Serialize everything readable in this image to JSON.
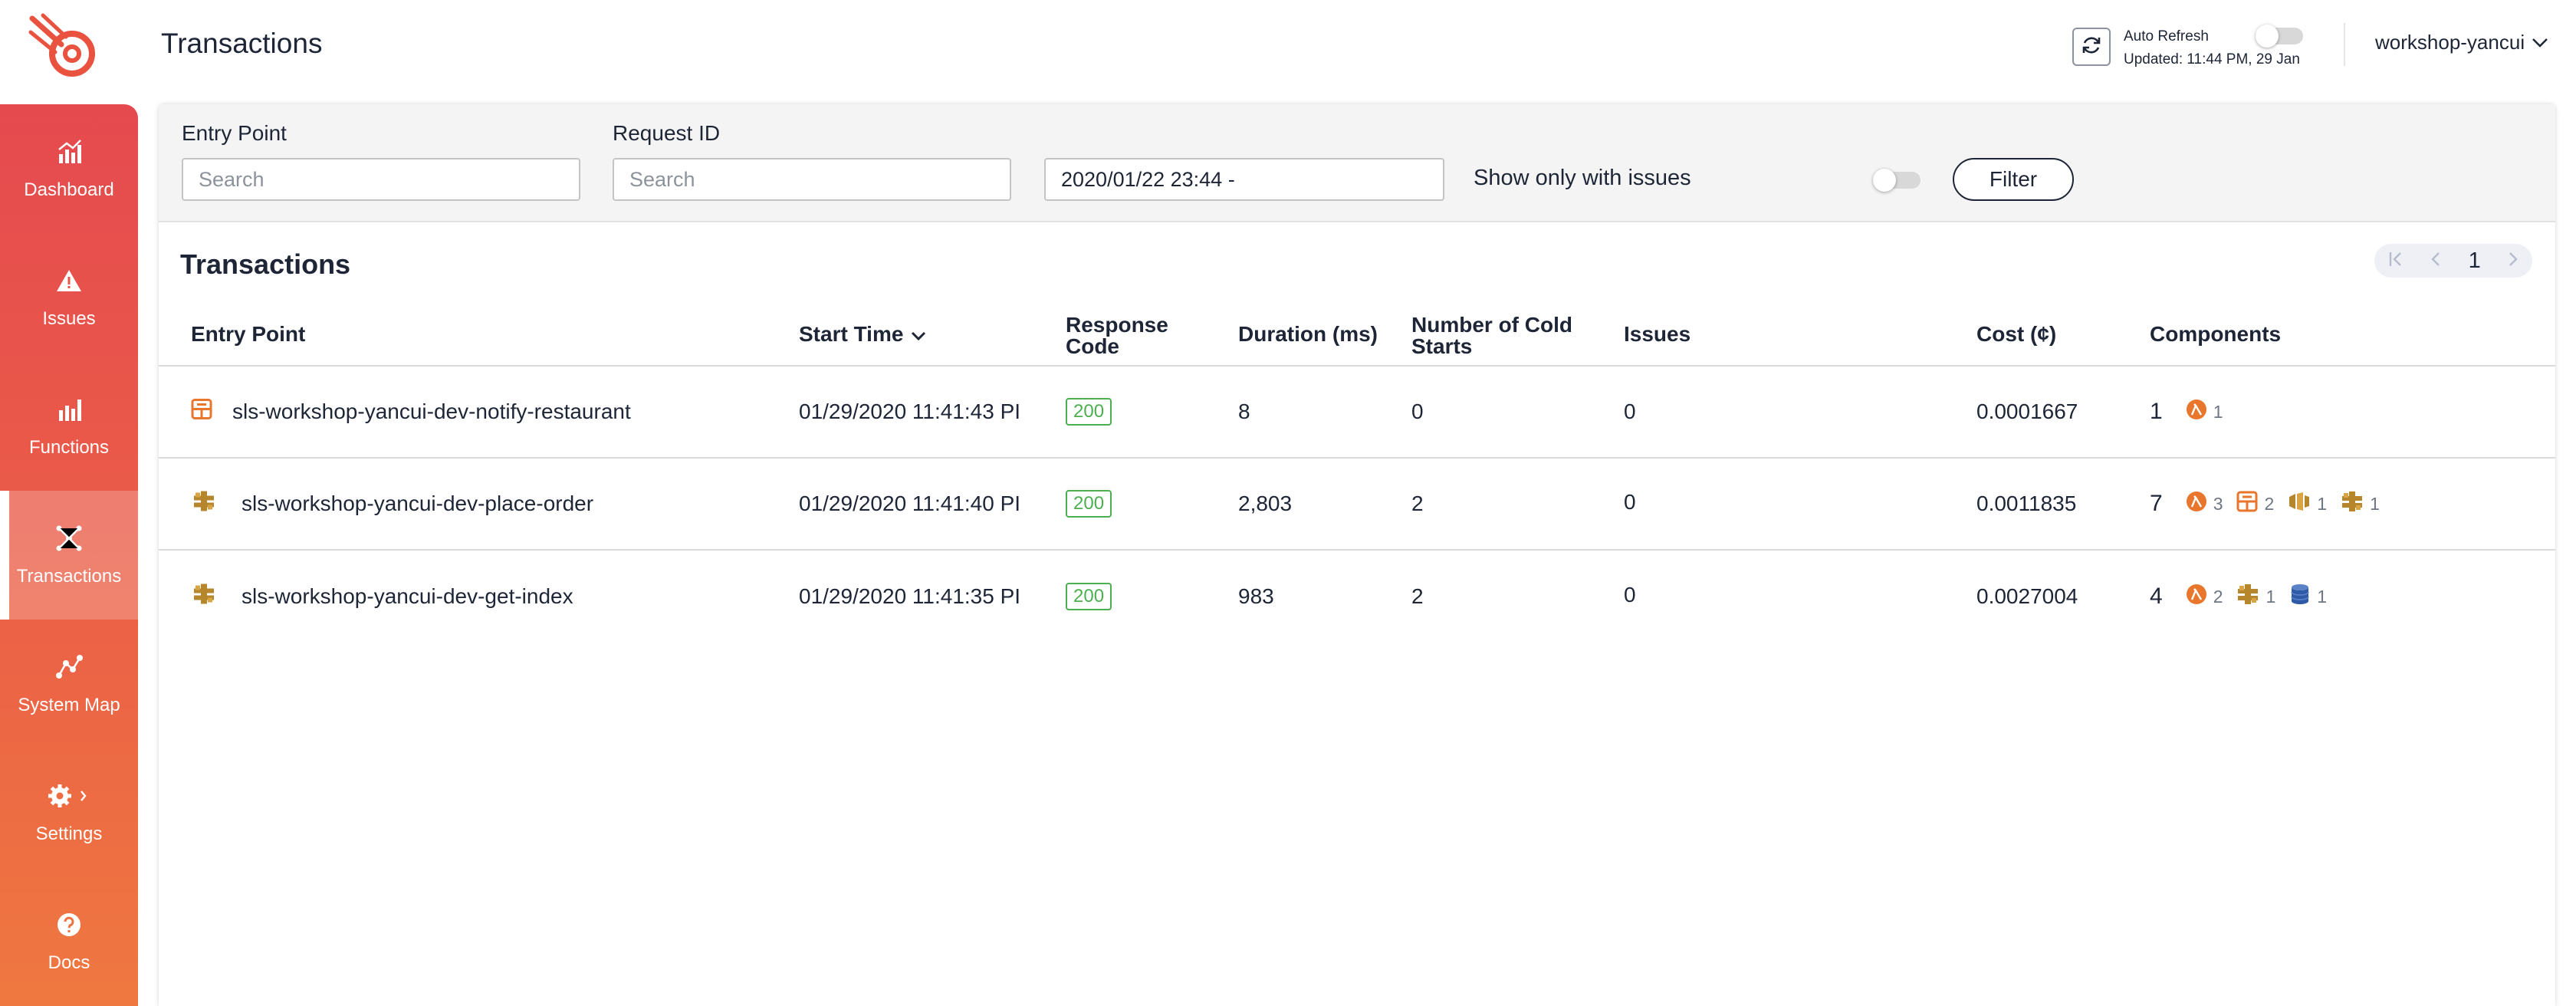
{
  "header": {
    "title": "Transactions",
    "auto_refresh_label": "Auto Refresh",
    "updated": "Updated: 11:44 PM, 29 Jan",
    "org": "workshop-yancui"
  },
  "sidebar": {
    "items": [
      {
        "label": "Dashboard",
        "icon": "chart-icon"
      },
      {
        "label": "Issues",
        "icon": "warning-icon"
      },
      {
        "label": "Functions",
        "icon": "bar-icon"
      },
      {
        "label": "Transactions",
        "icon": "transactions-icon",
        "active": true
      },
      {
        "label": "System Map",
        "icon": "map-icon"
      },
      {
        "label": "Settings",
        "icon": "gear-icon"
      },
      {
        "label": "Docs",
        "icon": "help-icon"
      }
    ]
  },
  "filters": {
    "entry_point_label": "Entry Point",
    "entry_point_placeholder": "Search",
    "request_id_label": "Request ID",
    "request_id_placeholder": "Search",
    "date_value": "2020/01/22 23:44 -",
    "issues_only_label": "Show only with issues",
    "filter_button": "Filter"
  },
  "table": {
    "title": "Transactions",
    "page": "1",
    "columns": {
      "entry_point": "Entry Point",
      "start_time": "Start Time",
      "response_code": "Response Code",
      "duration": "Duration (ms)",
      "cold_starts": "Number of Cold Starts",
      "issues": "Issues",
      "cost": "Cost (¢)",
      "components": "Components"
    },
    "rows": [
      {
        "entry_icon": "sns-icon",
        "entry_point": "sls-workshop-yancui-dev-notify-restaurant",
        "start_time": "01/29/2020  11:41:43 PI",
        "response_code": "200",
        "duration": "8",
        "cold_starts": "0",
        "issues": "0",
        "cost": "0.0001667",
        "components_total": "1",
        "components": [
          {
            "icon": "lambda-icon",
            "count": "1"
          }
        ]
      },
      {
        "entry_icon": "api-gateway-icon",
        "entry_point": "sls-workshop-yancui-dev-place-order",
        "start_time": "01/29/2020  11:41:40 PI",
        "response_code": "200",
        "duration": "2,803",
        "cold_starts": "2",
        "issues": "0",
        "cost": "0.0011835",
        "components_total": "7",
        "components": [
          {
            "icon": "lambda-icon",
            "count": "3"
          },
          {
            "icon": "sns-icon",
            "count": "2"
          },
          {
            "icon": "kinesis-icon",
            "count": "1"
          },
          {
            "icon": "api-gateway-icon",
            "count": "1"
          }
        ]
      },
      {
        "entry_icon": "api-gateway-icon",
        "entry_point": "sls-workshop-yancui-dev-get-index",
        "start_time": "01/29/2020  11:41:35 PI",
        "response_code": "200",
        "duration": "983",
        "cold_starts": "2",
        "issues": "0",
        "cost": "0.0027004",
        "components_total": "4",
        "components": [
          {
            "icon": "lambda-icon",
            "count": "2"
          },
          {
            "icon": "api-gateway-icon",
            "count": "1"
          },
          {
            "icon": "dynamodb-icon",
            "count": "1"
          }
        ]
      }
    ]
  },
  "colors": {
    "sidebar_top": "#e54a4f",
    "sidebar_bottom": "#ef7840",
    "badge_green": "#4caf50",
    "lambda_orange": "#e8762d",
    "apigw_gold": "#b5862b",
    "dynamo_blue": "#2e5aa8"
  }
}
